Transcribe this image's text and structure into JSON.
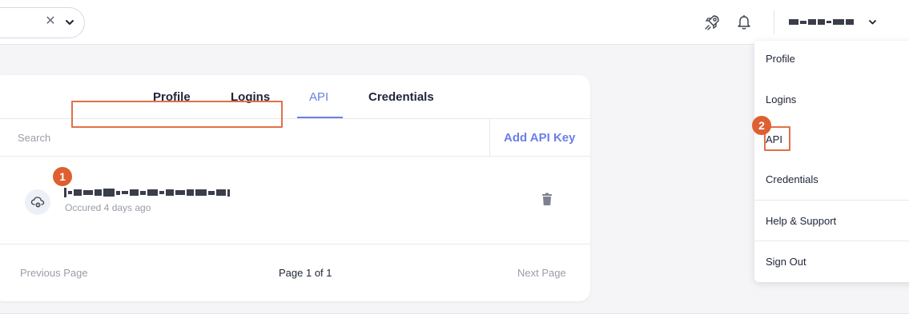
{
  "topbar": {
    "filter": {
      "clear_icon": "close-icon",
      "toggle_icon": "chevron-down-icon"
    },
    "icons": [
      "rocket-icon",
      "bell-icon"
    ],
    "user_menu": {
      "toggle_icon": "chevron-down-icon"
    }
  },
  "card": {
    "tabs": [
      {
        "label": "Profile",
        "active": false
      },
      {
        "label": "Logins",
        "active": false
      },
      {
        "label": "API",
        "active": true
      },
      {
        "label": "Credentials",
        "active": false
      }
    ],
    "search": {
      "placeholder": "Search",
      "value": ""
    },
    "add_button_label": "Add API Key",
    "api_keys": [
      {
        "subtitle": "Occured 4 days ago",
        "icon": "cloud-gear-icon",
        "delete_icon": "trash-icon"
      }
    ],
    "pagination": {
      "previous_label": "Previous Page",
      "page_info": "Page 1 of 1",
      "next_label": "Next Page"
    }
  },
  "dropdown": {
    "items": [
      {
        "label": "Profile"
      },
      {
        "label": "Logins"
      },
      {
        "label": "API"
      },
      {
        "label": "Credentials"
      },
      {
        "label": "Help & Support"
      },
      {
        "label": "Sign Out"
      }
    ]
  },
  "annotations": [
    {
      "number": "1"
    },
    {
      "number": "2"
    }
  ],
  "colors": {
    "accent": "#6b7fe8",
    "annotation": "#de5f31",
    "highlight_border": "#e0704a",
    "text": "#22263a",
    "muted": "#9a9da8"
  }
}
